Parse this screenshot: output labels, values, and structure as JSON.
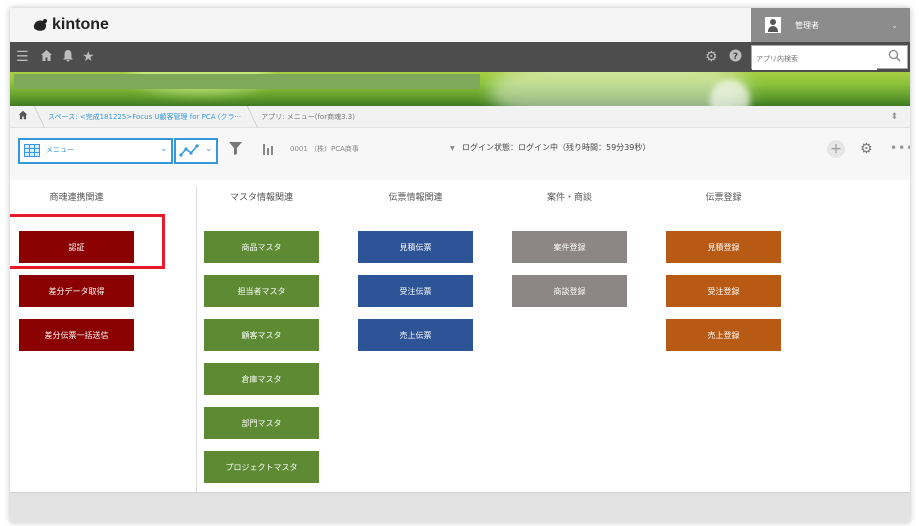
{
  "header": {
    "logo_text": "kintone",
    "user_name": "管理者",
    "user_chevron": "⌄"
  },
  "toolbar": {
    "search_placeholder": "アプリ内検索"
  },
  "breadcrumb": {
    "space": "スペース: <完成181225>Focus U顧客管理 for PCA (クラ···",
    "app": "アプリ: メニュー(for商魂3.3)"
  },
  "viewbar": {
    "view_label": "メニュー",
    "app_query": "0001 （株）PCA商事",
    "login_status": "ログイン状態：ログイン中（残り時間：59分39秒）"
  },
  "columns": [
    {
      "heading": "商魂連携関連",
      "color": "#8b0000",
      "buttons": [
        "認証",
        "差分データ取得",
        "差分伝票一括送信"
      ]
    },
    {
      "heading": "マスタ情報関連",
      "color": "#5d8a33",
      "buttons": [
        "商品マスタ",
        "担当者マスタ",
        "顧客マスタ",
        "倉庫マスタ",
        "部門マスタ",
        "プロジェクトマスタ"
      ]
    },
    {
      "heading": "伝票情報関連",
      "color": "#2d5496",
      "buttons": [
        "見積伝票",
        "受注伝票",
        "売上伝票"
      ]
    },
    {
      "heading": "案件・商談",
      "color": "#8c8686",
      "buttons": [
        "案件登録",
        "商談登録"
      ]
    },
    {
      "heading": "伝票登録",
      "color": "#b85a14",
      "buttons": [
        "見積登録",
        "受注登録",
        "売上登録"
      ]
    }
  ],
  "highlight_color": "#e8192c",
  "icons": [
    "menu-icon",
    "home-icon",
    "bell-icon",
    "star-icon",
    "gear-icon",
    "help-icon",
    "search-icon",
    "pin-icon",
    "filter-icon",
    "chart-icon",
    "plus-icon",
    "more-icon"
  ]
}
